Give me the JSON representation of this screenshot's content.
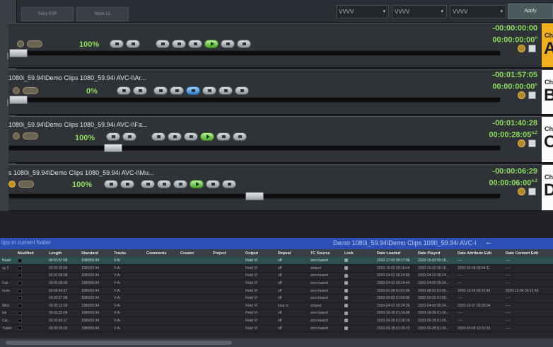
{
  "toolbar": {
    "tab1": "Sony E3P",
    "tab2": "Mock L1",
    "select1": "VVVV",
    "select2": "VVVV",
    "select3": "VVVV",
    "apply": "Apply"
  },
  "channels": [
    {
      "id": "A",
      "path": "",
      "percent": "100%",
      "tc_main": "-00:00:00:00",
      "tc_sub": "00:00:00:00",
      "tc_sub_suffix": "n",
      "label_small": "Ch",
      "label_big": "A",
      "active": true,
      "progress_fraction": 0.0
    },
    {
      "id": "B",
      "path": "1080i_59.94\\Demo Clips 1080_59.94i AVC-I\\Ar...",
      "percent": "0%",
      "tc_main": "-00:01:57:05",
      "tc_sub": "00:00:00:00",
      "tc_sub_suffix": "n",
      "label_small": "Ch",
      "label_big": "B",
      "active": false,
      "progress_fraction": 0.0
    },
    {
      "id": "C",
      "path": "1080i_59.94\\Demo Clips 1080_59.94i AVC-I\\Fa...",
      "percent": "100%",
      "tc_main": "-00:01:40:28",
      "tc_sub": "00:00:28:05",
      "tc_sub_suffix": "n.2",
      "label_small": "Ch",
      "label_big": "C",
      "active": false,
      "progress_fraction": 0.2
    },
    {
      "id": "D",
      "path": "s 1080i_59.94\\Demo Clips 1080_59.94i AVC-I\\Mu...",
      "percent": "100%",
      "tc_main": "-00:00:06:29",
      "tc_sub": "00:00:06:00",
      "tc_sub_suffix": "n.2",
      "label_small": "Ch",
      "label_big": "D",
      "active": false,
      "progress_fraction": 0.5
    }
  ],
  "bin": {
    "left_text": "lips in current folder",
    "path": "Demo 1080i_59.94\\Demo Clips 1080_59.94i AVC-I",
    "arrow": "←"
  },
  "table": {
    "columns": [
      "",
      "Modified",
      "Length",
      "Standard",
      "Tracks",
      "Comments",
      "Creator",
      "Project",
      "Output",
      "Repeat",
      "TC Source",
      "Lock",
      "Date Loaded",
      "Date Played",
      "Date Attribute Edit",
      "Date Content Edit"
    ],
    "rows": [
      [
        "Head",
        "",
        "00:01:57:06",
        "1080/59.94",
        "V-A-",
        "",
        "",
        "",
        "Field VI",
        "off",
        "zero based",
        "",
        "2020-17-02 05:17:06",
        "2020-15-02 05:16...",
        "----",
        "----"
      ],
      [
        "ay 2",
        "",
        "00:02:30:06",
        "1080/59.94",
        "V-A-",
        "",
        "",
        "",
        "Field VI",
        "off",
        "striped",
        "",
        "2020-15-02 05:16:44",
        "2020-15-02 05:16...",
        "2020-09-08 09:58:11",
        "----"
      ],
      [
        "",
        "",
        "00:02:08:08",
        "1080/59.94",
        "V-A-",
        "",
        "",
        "",
        "Field VI",
        "off",
        "zero based",
        "",
        "2020-24-02 05:24:05",
        "2020-24-02 05:24...",
        "----",
        "----"
      ],
      [
        "Fair",
        "",
        "00:02:08:08",
        "1080/59.94",
        "V-A-",
        "",
        "",
        "",
        "Field VI",
        "off",
        "zero based",
        "",
        "2020-24-02 05:24:44",
        "2020-24-02 05:24...",
        "----",
        "----"
      ],
      [
        "rests",
        "",
        "00:06:44:27",
        "1080/59.94",
        "V-A-",
        "",
        "",
        "",
        "Field VI",
        "off",
        "zero based",
        "",
        "2020-01-28 01:01:06",
        "2020-28-01 01:06...",
        "2020-12-04 00:12:49",
        "2020-12-04 00:12:49"
      ],
      [
        "",
        "",
        "00:02:27:08",
        "1080/59.94",
        "V-A-",
        "",
        "",
        "",
        "Field VI",
        "off",
        "zero based",
        "",
        "2020-20-02 01:00:06",
        "2020-20-02 01:00...",
        "----",
        "----"
      ],
      [
        "Mtra",
        "",
        "00:02:13:00",
        "1080/59.94",
        "V-A-",
        "",
        "",
        "",
        "Field VI",
        "loop m",
        "striped",
        "",
        "2020-24-02 05:24:36",
        "2020-24-02 05:24...",
        "2020-26-07 09:36:04",
        "----"
      ],
      [
        "lair",
        "",
        "00:02:23:08",
        "1080/59.94",
        "V-A-",
        "",
        "",
        "",
        "Field VI",
        "off",
        "zero based",
        "",
        "2020-16-28 01:16:06",
        "2020-16-28 01:16...",
        "----",
        "----"
      ],
      [
        "Cal...",
        "",
        "00:02:50:17",
        "1080/59.94",
        "V-A-",
        "",
        "",
        "",
        "Field VI",
        "off",
        "zero based",
        "",
        "2020-26-28 01:26:16",
        "2020-26-28 01:26...",
        "----",
        "----"
      ],
      [
        "Trailer",
        "",
        "00:02:29:06",
        "1080/59.94",
        "V-A-",
        "",
        "",
        "",
        "Field VI",
        "off",
        "zero based",
        "",
        "2020-26-28 01:26:23",
        "2020-26-28 01:26...",
        "2020-05-09 10:01:16",
        "----"
      ]
    ]
  }
}
